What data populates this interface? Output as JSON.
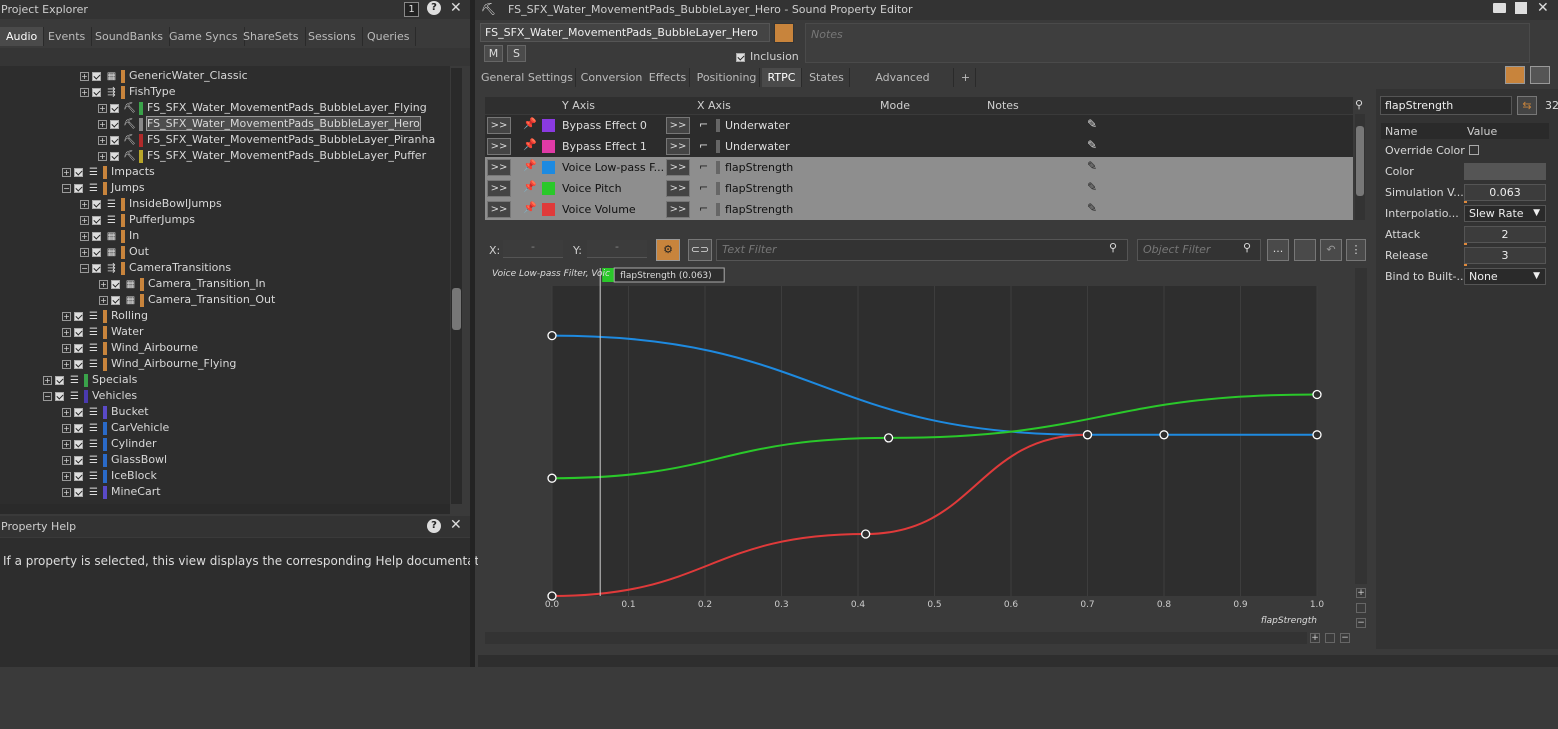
{
  "left": {
    "title": "Project Explorer",
    "tabs": [
      "Audio",
      "Events",
      "SoundBanks",
      "Game Syncs",
      "ShareSets",
      "Sessions",
      "Queries"
    ],
    "tree": [
      {
        "label": "GenericWater_Classic",
        "indent": 80,
        "icon": "grid",
        "color": "#c8843c"
      },
      {
        "label": "FishType",
        "indent": 80,
        "icon": "switch",
        "color": "#c8843c"
      },
      {
        "label": "FS_SFX_Water_MovementPads_BubbleLayer_Flying",
        "indent": 98,
        "icon": "sound",
        "color": "#3aa34a"
      },
      {
        "label": "FS_SFX_Water_MovementPads_BubbleLayer_Hero",
        "indent": 98,
        "icon": "sound",
        "color": "#888",
        "selected": true
      },
      {
        "label": "FS_SFX_Water_MovementPads_BubbleLayer_Piranha",
        "indent": 98,
        "icon": "sound",
        "color": "#b02a2a"
      },
      {
        "label": "FS_SFX_Water_MovementPads_BubbleLayer_Puffer",
        "indent": 98,
        "icon": "sound",
        "color": "#b8a62a"
      },
      {
        "label": "Impacts",
        "indent": 62,
        "icon": "actor",
        "color": "#c8843c"
      },
      {
        "label": "Jumps",
        "indent": 62,
        "icon": "actor",
        "color": "#c8843c",
        "open": true
      },
      {
        "label": "InsideBowlJumps",
        "indent": 80,
        "icon": "actor",
        "color": "#c8843c"
      },
      {
        "label": "PufferJumps",
        "indent": 80,
        "icon": "actor",
        "color": "#c8843c"
      },
      {
        "label": "In",
        "indent": 80,
        "icon": "grid",
        "color": "#c8843c"
      },
      {
        "label": "Out",
        "indent": 80,
        "icon": "grid",
        "color": "#c8843c"
      },
      {
        "label": "CameraTransitions",
        "indent": 80,
        "icon": "switch",
        "color": "#c8843c",
        "open": true
      },
      {
        "label": "Camera_Transition_In",
        "indent": 99,
        "icon": "grid",
        "color": "#c8843c"
      },
      {
        "label": "Camera_Transition_Out",
        "indent": 99,
        "icon": "grid",
        "color": "#c8843c"
      },
      {
        "label": "Rolling",
        "indent": 62,
        "icon": "actor",
        "color": "#c8843c"
      },
      {
        "label": "Water",
        "indent": 62,
        "icon": "actor",
        "color": "#c8843c"
      },
      {
        "label": "Wind_Airbourne",
        "indent": 62,
        "icon": "actor",
        "color": "#c8843c"
      },
      {
        "label": "Wind_Airbourne_Flying",
        "indent": 62,
        "icon": "actor",
        "color": "#c8843c"
      },
      {
        "label": "Specials",
        "indent": 43,
        "icon": "actor",
        "color": "#3aa34a"
      },
      {
        "label": "Vehicles",
        "indent": 43,
        "icon": "actor",
        "color": "#4a3ab0",
        "open": true
      },
      {
        "label": "Bucket",
        "indent": 62,
        "icon": "actor",
        "color": "#5a4ac8"
      },
      {
        "label": "CarVehicle",
        "indent": 62,
        "icon": "actor",
        "color": "#2a6ac8"
      },
      {
        "label": "Cylinder",
        "indent": 62,
        "icon": "actor",
        "color": "#2a6ac8"
      },
      {
        "label": "GlassBowl",
        "indent": 62,
        "icon": "actor",
        "color": "#2a6ac8"
      },
      {
        "label": "IceBlock",
        "indent": 62,
        "icon": "actor",
        "color": "#2a6ac8"
      },
      {
        "label": "MineCart",
        "indent": 62,
        "icon": "actor",
        "color": "#5a4ac8"
      }
    ]
  },
  "help": {
    "title": "Property Help",
    "text": "If a property is selected, this view displays the corresponding Help documentation."
  },
  "editor": {
    "title": "FS_SFX_Water_MovementPads_BubbleLayer_Hero - Sound Property Editor",
    "name": "FS_SFX_Water_MovementPads_BubbleLayer_Hero",
    "notes_placeholder": "Notes",
    "inclusion": "Inclusion",
    "m": "M",
    "s": "S",
    "tabs": [
      "General Settings",
      "Conversion",
      "Effects",
      "Positioning",
      "RTPC",
      "States",
      "Advanced Settings",
      "+"
    ],
    "columns": {
      "y": "Y Axis",
      "x": "X Axis",
      "mode": "Mode",
      "notes": "Notes"
    },
    "rows": [
      {
        "y": "Bypass Effect 0",
        "x": "Underwater",
        "color": "#8a3ae0",
        "gray": false
      },
      {
        "y": "Bypass Effect 1",
        "x": "Underwater",
        "color": "#e03aa6",
        "gray": false
      },
      {
        "y": "Voice Low-pass F...",
        "x": "flapStrength",
        "color": "#1e8ae0",
        "gray": true
      },
      {
        "y": "Voice Pitch",
        "x": "flapStrength",
        "color": "#2ac82a",
        "gray": true
      },
      {
        "y": "Voice Volume",
        "x": "flapStrength",
        "color": "#e03a3a",
        "gray": true
      }
    ],
    "btn_arrows": ">>",
    "x_label": "X:",
    "y_label": "Y:",
    "x_val": "-",
    "y_val": "-",
    "text_filter": "Text Filter",
    "object_filter": "Object Filter",
    "more": "...",
    "graph_title": "Voice Low-pass Filter, Voic",
    "cursor_label": "flapStrength (0.063)",
    "xaxis_label": "flapStrength",
    "ticks": [
      "0.0",
      "0.1",
      "0.2",
      "0.3",
      "0.4",
      "0.5",
      "0.6",
      "0.7",
      "0.8",
      "0.9",
      "1.0"
    ]
  },
  "props": {
    "search": "flapStrength",
    "count": "32",
    "col_name": "Name",
    "col_value": "Value",
    "rows": [
      {
        "name": "Override Color",
        "value": "",
        "kind": "check"
      },
      {
        "name": "Color",
        "value": "",
        "kind": "color"
      },
      {
        "name": "Simulation V...",
        "value": "0.063",
        "kind": "num"
      },
      {
        "name": "Interpolatio...",
        "value": "Slew Rate",
        "kind": "select"
      },
      {
        "name": "Attack",
        "value": "2",
        "kind": "num"
      },
      {
        "name": "Release",
        "value": "3",
        "kind": "num"
      },
      {
        "name": "Bind to Built-...",
        "value": "None",
        "kind": "select"
      }
    ]
  },
  "chart_data": {
    "type": "line",
    "xlabel": "flapStrength",
    "xlim": [
      0,
      1
    ],
    "cursor_x": 0.063,
    "series": [
      {
        "name": "Voice Low-pass Filter",
        "color": "#1e8ae0",
        "points": [
          [
            0,
            0.84
          ],
          [
            0.7,
            0.52
          ],
          [
            0.8,
            0.52
          ],
          [
            1.0,
            0.52
          ]
        ]
      },
      {
        "name": "Voice Pitch",
        "color": "#2ac82a",
        "points": [
          [
            0,
            0.38
          ],
          [
            0.44,
            0.51
          ],
          [
            1.0,
            0.65
          ]
        ]
      },
      {
        "name": "Voice Volume",
        "color": "#e03a3a",
        "points": [
          [
            0,
            0
          ],
          [
            0.41,
            0.2
          ],
          [
            0.7,
            0.52
          ]
        ]
      }
    ]
  }
}
